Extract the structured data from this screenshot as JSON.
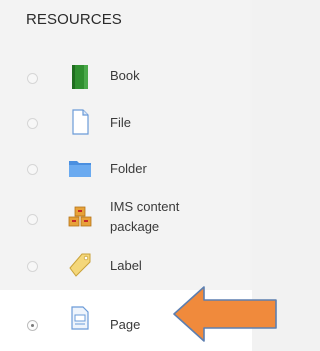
{
  "resources": {
    "heading": "RESOURCES",
    "items": [
      {
        "label": "Book"
      },
      {
        "label": "File"
      },
      {
        "label": "Folder"
      },
      {
        "label_line1": "IMS content",
        "label_line2": "package"
      },
      {
        "label": "Label"
      },
      {
        "label": "Page",
        "selected": true
      }
    ]
  },
  "colors": {
    "arrow": "#f08a3c",
    "arrow_border": "#5d7fb0"
  }
}
